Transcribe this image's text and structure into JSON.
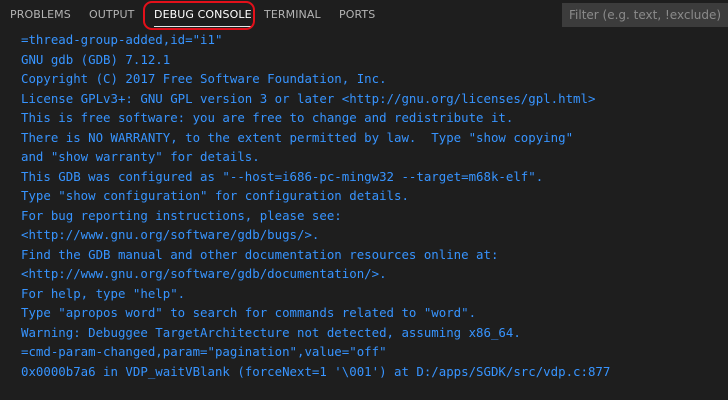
{
  "tabs": [
    {
      "label": "PROBLEMS"
    },
    {
      "label": "OUTPUT"
    },
    {
      "label": "DEBUG CONSOLE"
    },
    {
      "label": "TERMINAL"
    },
    {
      "label": "PORTS"
    }
  ],
  "filter": {
    "placeholder": "Filter (e.g. text, !exclude)"
  },
  "console": {
    "lines": [
      "=thread-group-added,id=\"i1\"",
      "GNU gdb (GDB) 7.12.1",
      "Copyright (C) 2017 Free Software Foundation, Inc.",
      "License GPLv3+: GNU GPL version 3 or later <http://gnu.org/licenses/gpl.html>",
      "This is free software: you are free to change and redistribute it.",
      "There is NO WARRANTY, to the extent permitted by law.  Type \"show copying\"",
      "and \"show warranty\" for details.",
      "This GDB was configured as \"--host=i686-pc-mingw32 --target=m68k-elf\".",
      "Type \"show configuration\" for configuration details.",
      "For bug reporting instructions, please see:",
      "<http://www.gnu.org/software/gdb/bugs/>.",
      "Find the GDB manual and other documentation resources online at:",
      "<http://www.gnu.org/software/gdb/documentation/>.",
      "For help, type \"help\".",
      "Type \"apropos word\" to search for commands related to \"word\".",
      "Warning: Debuggee TargetArchitecture not detected, assuming x86_64.",
      "=cmd-param-changed,param=\"pagination\",value=\"off\"",
      "0x0000b7a6 in VDP_waitVBlank (forceNext=1 '\\001') at D:/apps/SGDK/src/vdp.c:877"
    ]
  },
  "colors": {
    "background": "#1e1e1e",
    "console_text": "#3794ff",
    "annotation_ring": "#e3101a"
  }
}
